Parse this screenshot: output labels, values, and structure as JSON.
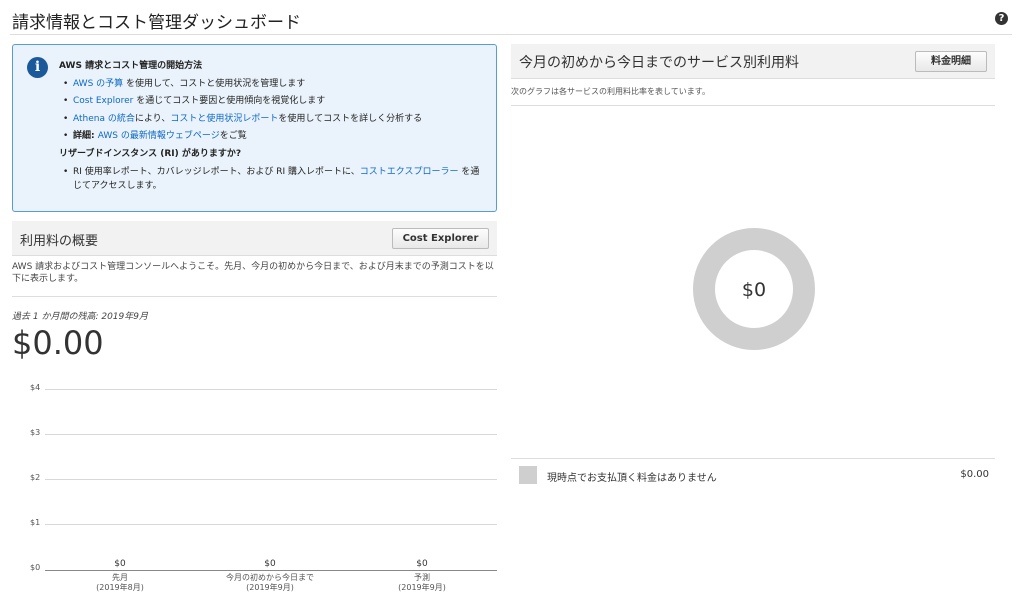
{
  "header": {
    "title": "請求情報とコスト管理ダッシュボード",
    "help_icon": "?"
  },
  "info_box": {
    "icon": "i",
    "heading": "AWS 請求とコスト管理の開始方法",
    "items": [
      {
        "link": "AWS の予算",
        "text": " を使用して、コストと使用状況を管理します"
      },
      {
        "link": "Cost Explorer",
        "text": " を通じてコスト要因と使用傾向を視覚化します"
      },
      {
        "link": "Athena の統合",
        "text": "により、",
        "link2": "コストと使用状況レポート",
        "text2": "を使用してコストを詳しく分析する"
      },
      {
        "prefix": "詳細: ",
        "link": "AWS の最新情報ウェブページ",
        "text": "をご覧"
      }
    ],
    "ri_heading": "リザーブドインスタンス (RI) がありますか?",
    "ri_item": {
      "text": "RI 使用率レポート、カバレッジレポート、および RI 購入レポートに、",
      "link": "コストエクスプローラー",
      "text2": " を通じてアクセスします。"
    }
  },
  "overview": {
    "title": "利用料の概要",
    "button": "Cost Explorer",
    "description": "AWS 請求およびコスト管理コンソールへようこそ。先月、今月の初めから今日まで、および月末までの予測コストを以下に表示します。",
    "balance_label": "過去 1 か月間の残高: 2019年9月",
    "balance_amount": "$0.00"
  },
  "chart_data": {
    "type": "bar",
    "categories": [
      "先月\n(2019年8月)",
      "今月の初めから今日まで\n(2019年9月)",
      "予測\n(2019年9月)"
    ],
    "category_lines": [
      [
        "先月",
        "(2019年8月)"
      ],
      [
        "今月の初めから今日まで",
        "(2019年9月)"
      ],
      [
        "予測",
        "(2019年9月)"
      ]
    ],
    "values": [
      0,
      0,
      0
    ],
    "value_labels": [
      "$0",
      "$0",
      "$0"
    ],
    "y_ticks": [
      "$4",
      "$3",
      "$2",
      "$1",
      "$0"
    ],
    "ylim": [
      0,
      4
    ],
    "grid": true
  },
  "service_panel": {
    "title": "今月の初めから今日までのサービス別利用料",
    "button": "料金明細",
    "description": "次のグラフは各サービスの利用料比率を表しています。",
    "donut_label": "$0",
    "legend_text": "現時点でお支払頂く料金はありません",
    "legend_value": "$0.00",
    "donut_color": "#cfcfcf"
  }
}
